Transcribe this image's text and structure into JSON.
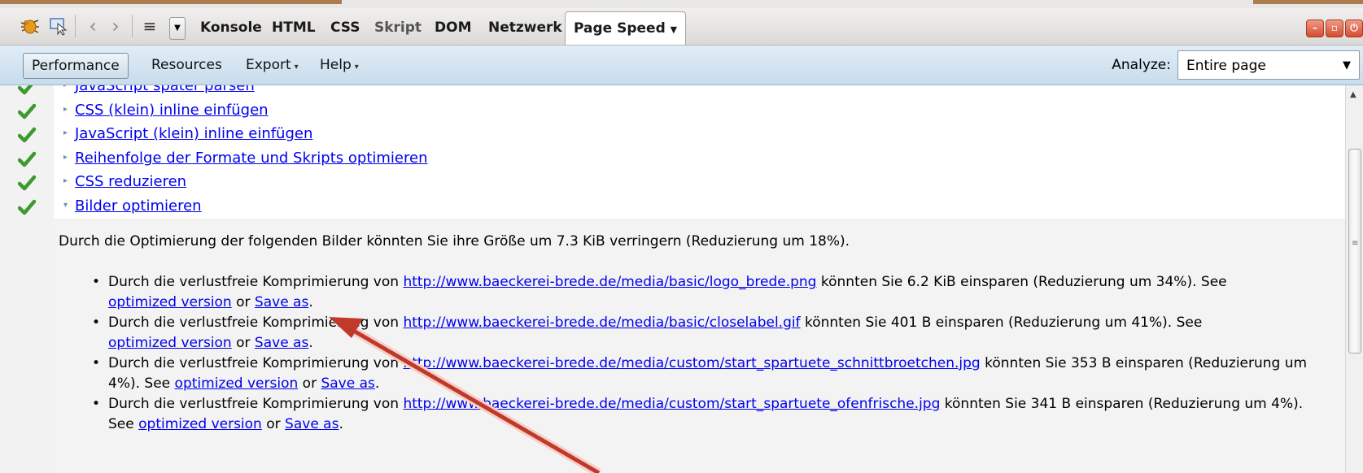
{
  "firebug_toolbar": {
    "tabs": [
      "Konsole",
      "HTML",
      "CSS",
      "Skript",
      "DOM",
      "Netzwerk"
    ],
    "active_tab": "Page Speed",
    "dim_tab": "Skript"
  },
  "pagespeed_toolbar": {
    "performance": "Performance",
    "resources": "Resources",
    "export": "Export",
    "help": "Help",
    "analyze_label": "Analyze:",
    "analyze_value": "Entire page"
  },
  "rules": [
    {
      "label": "JavaScript später parsen",
      "passed": true
    },
    {
      "label": "CSS (klein) inline einfügen",
      "passed": true
    },
    {
      "label": "JavaScript (klein) inline einfügen",
      "passed": true
    },
    {
      "label": "Reihenfolge der Formate und Skripts optimieren",
      "passed": true
    },
    {
      "label": "CSS reduzieren",
      "passed": true
    },
    {
      "label": "Bilder optimieren",
      "passed": true,
      "expanded": true
    }
  ],
  "details": {
    "summary": "Durch die Optimierung der folgenden Bilder könnten Sie ihre Größe um 7.3 KiB verringern (Reduzierung um 18%).",
    "prefix": "Durch die verlustfreie Komprimierung von",
    "see": "See",
    "optimized": "optimized version",
    "or": "or",
    "save": "Save as",
    "items": [
      {
        "url": "http://www.baeckerei-brede.de/media/basic/logo_brede.png",
        "saving": "könnten Sie 6.2 KiB einsparen (Reduzierung um 34%)."
      },
      {
        "url": "http://www.baeckerei-brede.de/media/basic/closelabel.gif",
        "saving": "könnten Sie 401 B einsparen (Reduzierung um 41%)."
      },
      {
        "url": "http://www.baeckerei-brede.de/media/custom/start_spartuete_schnittbroetchen.jpg",
        "saving": "könnten Sie 353 B einsparen (Reduzierung um 4%)."
      },
      {
        "url": "http://www.baeckerei-brede.de/media/custom/start_spartuete_ofenfrische.jpg",
        "saving": "könnten Sie 341 B einsparen (Reduzierung um 4%)."
      }
    ]
  },
  "colors": {
    "link": "#0000ee",
    "check": "#3d9a2f",
    "annotation_arrow": "#c0392b"
  }
}
